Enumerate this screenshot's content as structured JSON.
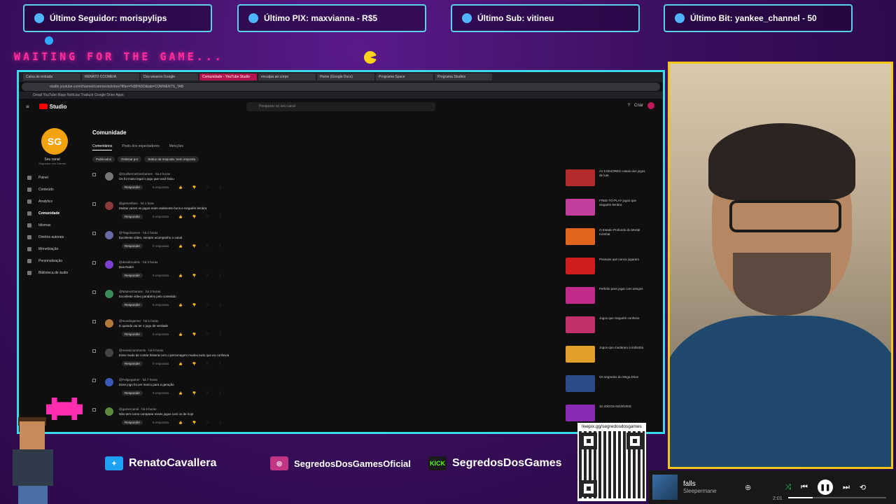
{
  "alerts": [
    {
      "label": "Último Seguidor: morispylips",
      "icon": "user-icon",
      "color": "#4fb5ff"
    },
    {
      "label": "Último PIX: maxvianna - R$5",
      "icon": "dollar-icon",
      "color": "#4fb5ff"
    },
    {
      "label": "Último Sub: vitineu",
      "icon": "star-icon",
      "color": "#4fb5ff"
    },
    {
      "label": "Último Bit: yankee_channel - 50",
      "icon": "diamond-icon",
      "color": "#4fb5ff"
    }
  ],
  "waiting_text": "WAITING FOR THE GAME...",
  "browser": {
    "tabs": [
      "Caixa de entrada",
      "RENATO CCOMEIA",
      "Dos weseno Google",
      "Comunidade - YouTube Studio",
      "encaijas ao corpo",
      "Home (Google Docs)",
      "Programa Space",
      "Programa Studios"
    ],
    "url": "studio.youtube.com/channel/comments/inbox?filter=%5B%5D&tab=COMMENTS_TAB",
    "bookmarks": "Gmail   YouTube   Maps   Notícias   Traduzir   Google Drive   Apps"
  },
  "studio": {
    "logo": "Studio",
    "search_placeholder": "Pesquisar no seu canal",
    "create_label": "Criar",
    "channel_name": "Seu canal",
    "channel_sub": "Segredos dos Games",
    "nav": [
      "Painel",
      "Conteúdo",
      "Analytics",
      "Comunidade",
      "Idiomas",
      "Direitos autorais",
      "Monetização",
      "Personalização",
      "Biblioteca de áudio"
    ],
    "active_nav": 3,
    "page_title": "Comunidade",
    "tabs": [
      "Comentários",
      "Posts dos espectadores",
      "Menções"
    ],
    "filters": [
      "Publicados",
      "Ordenar por",
      "Status da resposta: Sem resposta"
    ],
    "reply_label": "Responder",
    "replies_label": "0 respostas",
    "comments": [
      {
        "author": "@GuilhermeDosGames · há 4 horas",
        "text": "Os foi muito legal o jogo que você falou",
        "video": "As 5 MAIORES coisas dos jogos de luta",
        "avatar": "#777",
        "thumb": "#b52a2a"
      },
      {
        "author": "@gamesfans · há 1 hora",
        "text": "Muitas vezes os jogos eram realmente bons e ninguém lembra",
        "video": "FREE-TO-PLAY jogos que ninguém lembra",
        "avatar": "#8a3b3b",
        "thumb": "#c23fa0"
      },
      {
        "author": "@TiagoGames · há 2 horas",
        "text": "Excelente vídeo, sempre acompanho o canal",
        "video": "O Estado Profundo do Mortal Kombat",
        "avatar": "#6a6aa8",
        "thumb": "#e0641c"
      },
      {
        "author": "@davidmodetc · há 3 horas",
        "text": "Boa Noite!",
        "video": "Pessoas que nunca jogaram",
        "avatar": "#7b3fd1",
        "thumb": "#d01c1c"
      },
      {
        "author": "@MateusGames · há 3 horas",
        "text": "Excelente vídeo parabéns pelo conteúdo",
        "video": "Perfeito para jogar com amigos",
        "avatar": "#3b8a5a",
        "thumb": "#c02a8a"
      },
      {
        "author": "@mundogamer · há 5 horas",
        "text": "E quando vai ter o jogo de verdade",
        "video": "Jogos que ninguém conhece",
        "avatar": "#b57a3b",
        "thumb": "#c0306a"
      },
      {
        "author": "@renatocomments · há 6 horas",
        "text": "Esse modo de contar historia com o personagem mudou tudo que eu conhecia",
        "video": "Jogos que mudaram a indústria",
        "avatar": "#444",
        "thumb": "#e0a02a"
      },
      {
        "author": "@Felipegamer · há 7 horas",
        "text": "Esse jogo foi um marco para a geração",
        "video": "Os segredos do Mega Drive",
        "avatar": "#3b5ab5",
        "thumb": "#2a4a8a"
      },
      {
        "author": "@gamercanal · há 8 horas",
        "text": "Não tem como comparar esses jogos com os de hoje",
        "video": "10 JOGOS INCRÍVEIS",
        "avatar": "#5a8a3b",
        "thumb": "#8a2ab5"
      }
    ]
  },
  "social": [
    {
      "handle": "RenatoCavallera",
      "badge": "tw",
      "color": "#1da1f2"
    },
    {
      "handle": "SegredosDosGamesOficial",
      "badge": "ig",
      "color": "#c13584"
    },
    {
      "handle": "SegredosDosGames",
      "badge": "KICK",
      "color": "#53fc18"
    }
  ],
  "qr_label": "livepix.gg/segredosdosgames",
  "player": {
    "title": "falls",
    "artist": "Sleepermane",
    "time": "2:01",
    "progress": 0.25
  }
}
